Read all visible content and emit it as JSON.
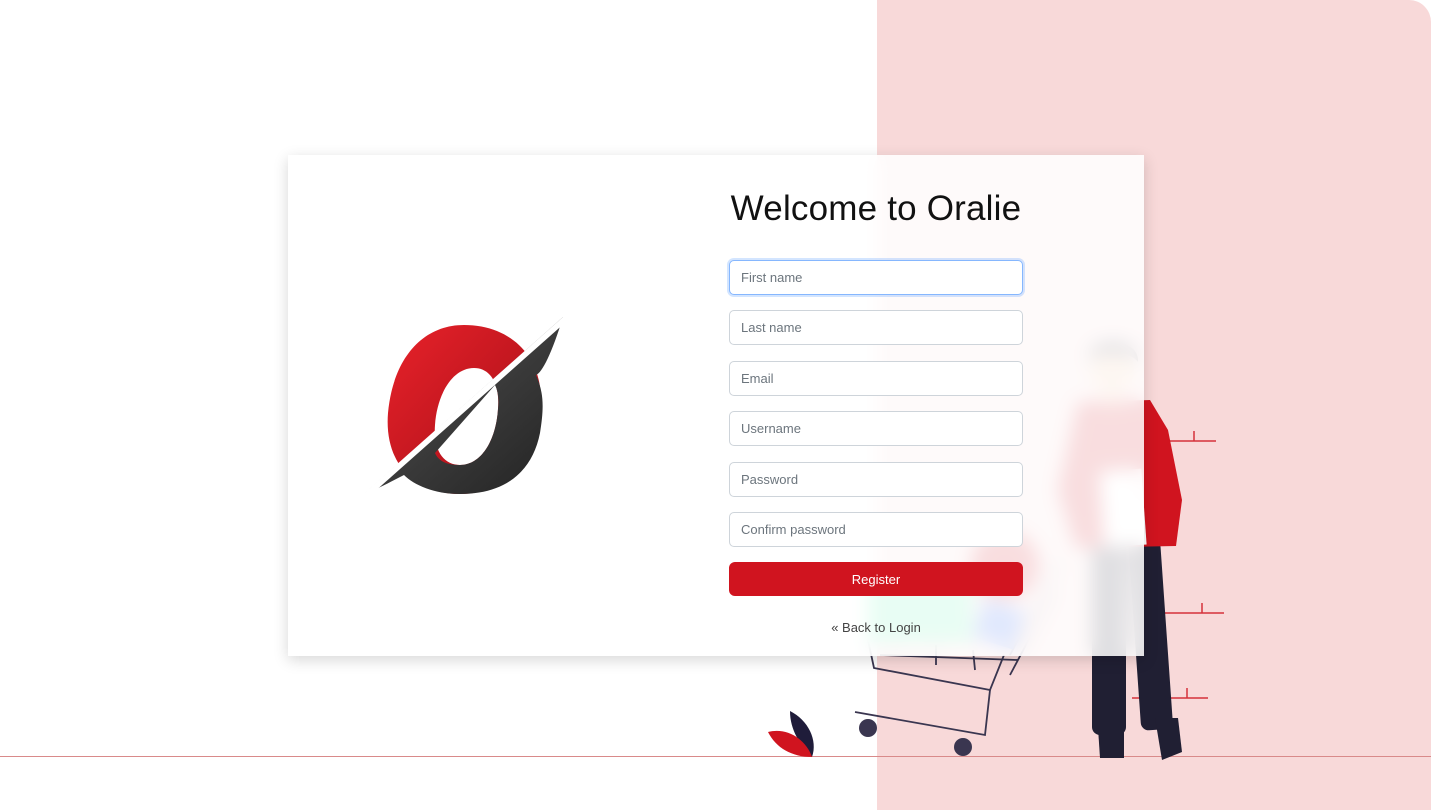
{
  "brand": {
    "logo_letter": "O",
    "colors": {
      "red": "#d0141f",
      "dark": "#2e2e2e",
      "panel": "#f8d9d9"
    }
  },
  "form": {
    "title": "Welcome to Oralie",
    "fields": [
      {
        "key": "first_name",
        "placeholder": "First name",
        "value": "",
        "focused": true
      },
      {
        "key": "last_name",
        "placeholder": "Last name",
        "value": ""
      },
      {
        "key": "email",
        "placeholder": "Email",
        "value": ""
      },
      {
        "key": "username",
        "placeholder": "Username",
        "value": ""
      },
      {
        "key": "password",
        "placeholder": "Password",
        "value": ""
      },
      {
        "key": "confirm_password",
        "placeholder": "Confirm password",
        "value": ""
      }
    ],
    "submit_label": "Register",
    "back_link": "« Back to Login"
  },
  "illustration": {
    "description_icon": "shopper-with-cart-illustration"
  }
}
